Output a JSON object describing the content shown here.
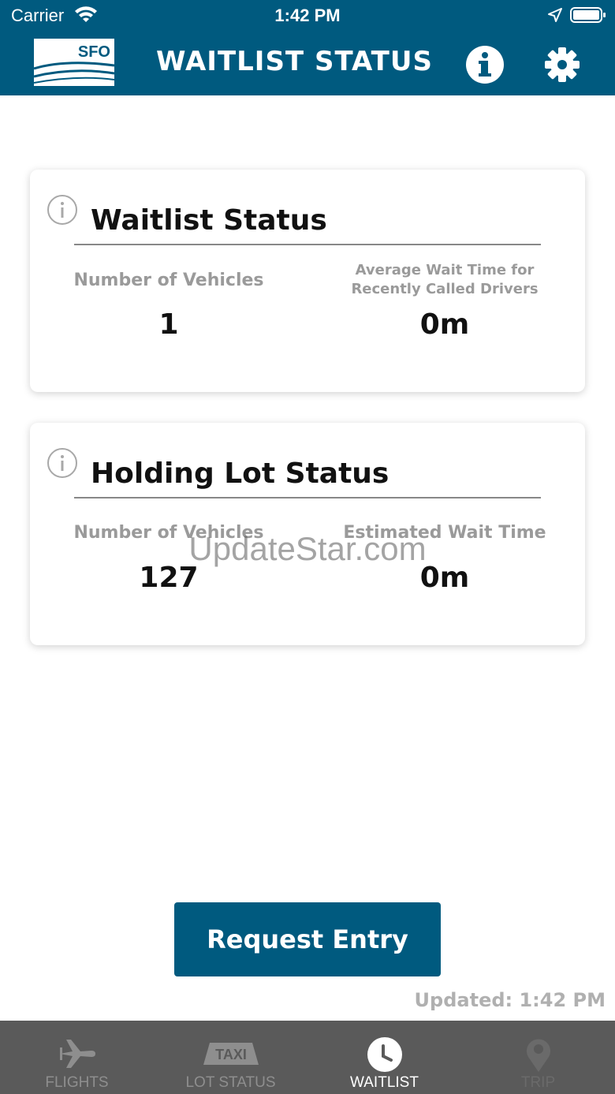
{
  "status_bar": {
    "carrier": "Carrier",
    "time": "1:42 PM"
  },
  "header": {
    "logo_text": "SFO",
    "title": "WAITLIST STATUS"
  },
  "waitlist_card": {
    "title": "Waitlist Status",
    "left_label": "Number of Vehicles",
    "left_value": "1",
    "right_label_line1": "Average Wait Time for",
    "right_label_line2": "Recently Called Drivers",
    "right_value": "0m"
  },
  "holding_card": {
    "title": "Holding Lot Status",
    "left_label": "Number of Vehicles",
    "left_value": "127",
    "right_label": "Estimated Wait Time",
    "right_value": "0m"
  },
  "watermark": "UpdateStar.com",
  "actions": {
    "request_entry": "Request Entry"
  },
  "updated_text": "Updated: 1:42 PM",
  "tabs": [
    {
      "label": "FLIGHTS",
      "icon": "airplane-icon"
    },
    {
      "label": "LOT STATUS",
      "icon": "taxi-icon",
      "icon_text": "TAXI"
    },
    {
      "label": "WAITLIST",
      "icon": "clock-icon",
      "active": true
    },
    {
      "label": "TRIP",
      "icon": "map-pin-icon",
      "disabled": true
    }
  ],
  "colors": {
    "brand": "#005a7f",
    "tabbar": "#5a5a5a"
  }
}
